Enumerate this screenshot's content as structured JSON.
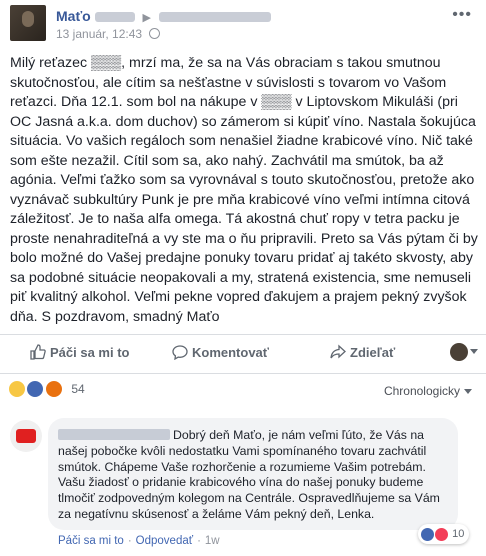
{
  "post": {
    "author": "Maťo",
    "timestamp": "13 január, 12:43",
    "text": "Milý reťazec ▒▒▒, mrzí ma, že sa na Vás obraciam s takou smutnou skutočnosťou, ale cítim sa nešťastne v súvislosti s tovarom vo Vašom reťazci. Dňa 12.1. som bol na nákupe v ▒▒▒ v Liptovskom Mikuláši (pri OC Jasná a.k.a. dom duchov) so zámerom si kúpiť víno. Nastala šokujúca situácia. Vo vašich regáloch som nenašiel žiadne krabicové víno. Nič také som ešte nezažil. Cítil som sa, ako nahý. Zachvátil ma smútok, ba až agónia. Veľmi ťažko som sa vyrovnával s touto skutočnosťou, pretože ako vyznávač subkultúry Punk je pre mňa krabicové víno veľmi intímna citová záležitosť. Je to naša alfa omega. Tá akostná chuť ropy v tetra packu je proste nenahraditeľná a vy ste ma o ňu pripravili. Preto sa Vás pýtam či by bolo možné do Vašej predajne ponuky tovaru pridať aj takéto skvosty, aby sa podobné situácie neopakovali a my, stratená existencia, sme nemuseli piť kvalitný alkohol. Veľmi pekne vopred ďakujem a prajem pekný zvyšok dňa. S pozdravom, smadný Maťo",
    "more_icon": "ellipsis-icon"
  },
  "actions": {
    "like_label": "Páči sa mi to",
    "comment_label": "Komentovať",
    "share_label": "Zdieľať"
  },
  "reactions": {
    "count": "54",
    "icons": [
      "haha-icon",
      "like-icon",
      "angry-icon"
    ],
    "sort_label": "Chronologicky"
  },
  "comment": {
    "text": "Dobrý deň Maťo, je nám veľmi ľúto, že Vás na našej pobočke kvôli nedostatku Vami spomínaného tovaru zachvátil smútok. Chápeme Vaše rozhorčenie a rozumieme Vašim potrebám. Vašu žiadosť o pridanie krabicového vína do našej ponuky budeme tlmočiť zodpovedným kolegom na Centrále. Ospravedlňujeme sa Vám za negatívnu skúsenosť a želáme Vám pekný deň, Lenka.",
    "reaction_count": "10",
    "like_label": "Páči sa mi to",
    "reply_label": "Odpovedať",
    "age": "1w"
  },
  "colors": {
    "link": "#385898",
    "like_blue": "#4267b2",
    "muted": "#90949c",
    "bubble": "#f2f3f5"
  }
}
